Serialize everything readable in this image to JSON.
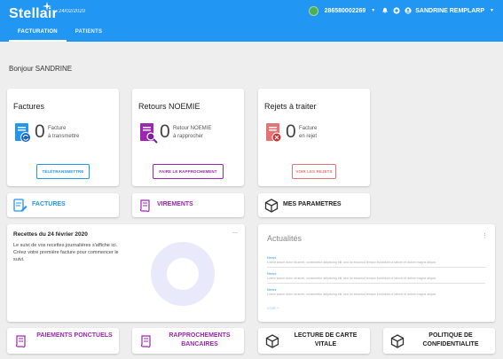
{
  "header": {
    "logo": "Stellair",
    "date": "24/02/2020",
    "phone": "286580002269",
    "user": "SANDRINE REMPLARP",
    "tabs": [
      {
        "label": "FACTURATION",
        "active": true
      },
      {
        "label": "PATIENTS",
        "active": false
      }
    ],
    "colors": {
      "bar": "#2196f3",
      "status": "#4caf50"
    }
  },
  "greeting": "Bonjour SANDRINE",
  "cards": {
    "factures": {
      "title": "Factures",
      "count": "0",
      "label1": "Facture",
      "label2": "à transmettre",
      "button": "TÉLÉTRANSMETTRE",
      "color": "#2196f3",
      "icon": "invoice-sync-icon"
    },
    "retours": {
      "title": "Retours NOEMIE",
      "count": "0",
      "label1": "Retour NOEMIE",
      "label2": "à rapprocher",
      "button": "FAIRE LE RAPPROCHEMENT",
      "color": "#9c27b0",
      "icon": "document-search-icon"
    },
    "rejets": {
      "title": "Rejets à traiter",
      "count": "0",
      "label1": "Facture",
      "label2": "en rejet",
      "button": "VOIR LES REJETS",
      "color": "#e57373",
      "icon": "document-reject-icon"
    }
  },
  "shortcuts": {
    "factures": "FACTURES",
    "virements": "VIREMENTS",
    "parametres": "MES PARAMETRES"
  },
  "recettes": {
    "title": "Recettes du 24 février 2020",
    "menu": "...",
    "text": "Le suivi de vos recettes journalières s'affiche ici. Créez votre première facture pour commencer le suivi."
  },
  "actualites": {
    "title": "Actualités",
    "menu": "⋮",
    "items": [
      {
        "title": "News",
        "text": "Lorem ipsum dolor sit amet, consectetur adipiscing elit, sed do eiusmod tempor incididunt ut labore et dolore magna aliqua."
      },
      {
        "title": "News",
        "text": "Lorem ipsum dolor sit amet, consectetur adipiscing elit, sed do eiusmod tempor incididunt ut labore et dolore magna aliqua."
      },
      {
        "title": "News",
        "text": "Lorem ipsum dolor sit amet, consectetur adipiscing elit, sed do eiusmod tempor incididunt ut labore et dolore magna aliqua."
      }
    ],
    "more": "VOIR +"
  },
  "bottom": {
    "paiements": "PAIEMENTS PONCTUELS",
    "rapprochements": "RAPPROCHEMENTS BANCAIRES",
    "lecture": "LECTURE DE CARTE VITALE",
    "politique": "POLITIQUE DE CONFIDENTIALITE"
  }
}
